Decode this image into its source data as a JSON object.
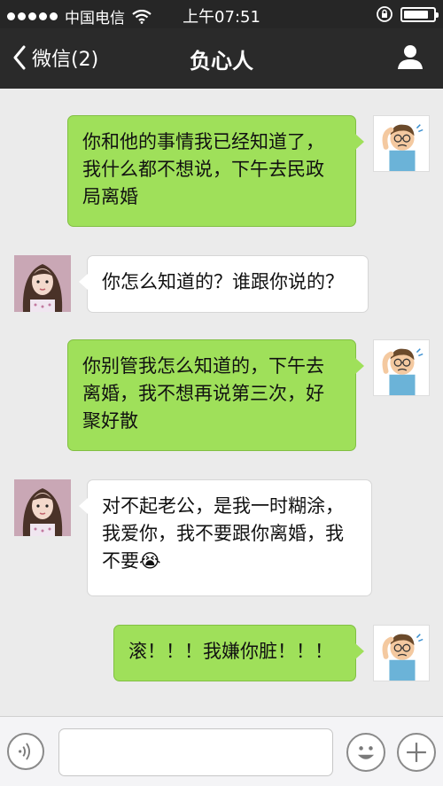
{
  "status_bar": {
    "carrier": "中国电信",
    "time": "上午07:51",
    "battery_level": 0.85
  },
  "nav": {
    "back_label": "微信(2)",
    "title": "负心人"
  },
  "messages": [
    {
      "sender": "me",
      "text": "你和他的事情我已经知道了，我什么都不想说，下午去民政局离婚"
    },
    {
      "sender": "her",
      "text": "你怎么知道的？谁跟你说的？"
    },
    {
      "sender": "me",
      "text": "你别管我怎么知道的，下午去离婚，我不想再说第三次，好聚好散"
    },
    {
      "sender": "her",
      "text": "对不起老公，是我一时糊涂，我爱你，我不要跟你离婚，我不要",
      "emoji": "😭"
    },
    {
      "sender": "me",
      "text": "滚！！！我嫌你脏！！！"
    }
  ],
  "input": {
    "value": ""
  },
  "icons": {
    "back": "chevron-left-icon",
    "profile": "person-icon",
    "voice": "voice-icon",
    "emoji": "smiley-icon",
    "more": "plus-icon"
  }
}
